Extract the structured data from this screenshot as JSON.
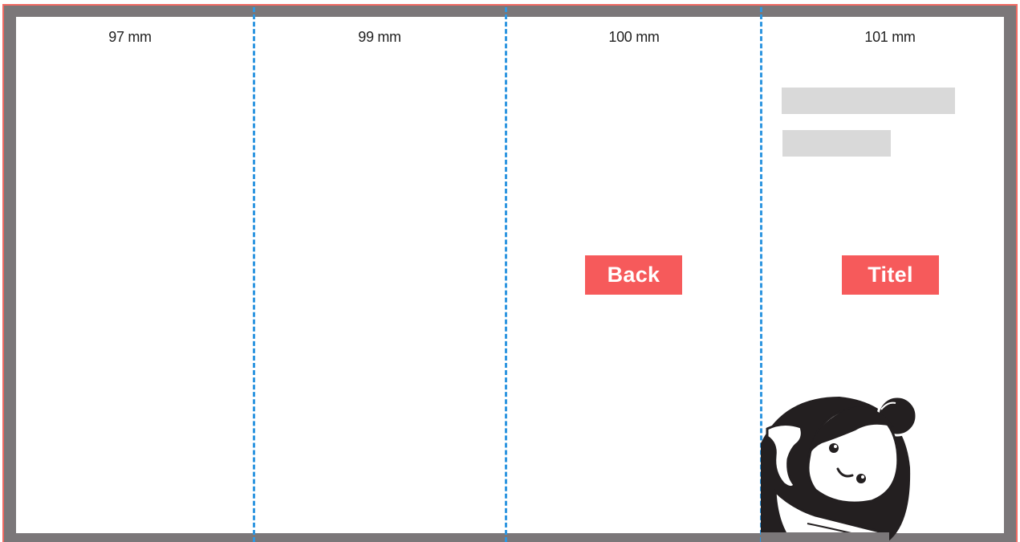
{
  "panels": [
    {
      "width_label": "97 mm"
    },
    {
      "width_label": "99 mm"
    },
    {
      "width_label": "100 mm"
    },
    {
      "width_label": "101 mm"
    }
  ],
  "labels": {
    "back": "Back",
    "title": "Titel"
  },
  "colors": {
    "bleed": "#f26a63",
    "safe_margin": "#7b7779",
    "fold_line": "#2f96e0",
    "label_fill": "#f65a5b",
    "placeholder": "#d9d9d9"
  },
  "icons": {
    "mascot": "girl-mascot-icon"
  }
}
